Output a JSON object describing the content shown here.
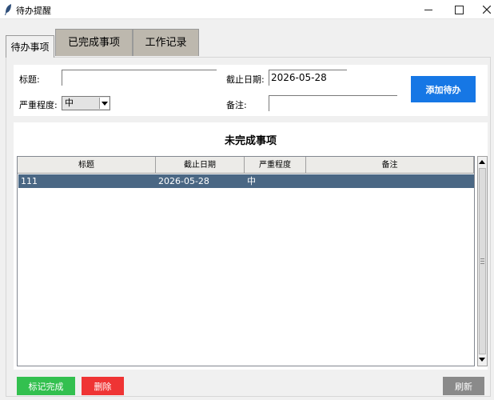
{
  "window": {
    "title": "待办提醒",
    "app_icon": "feather-icon"
  },
  "tabs": [
    {
      "label": "待办事项",
      "active": true
    },
    {
      "label": "已完成事项",
      "active": false
    },
    {
      "label": "工作记录",
      "active": false
    }
  ],
  "form": {
    "title_label": "标题:",
    "title_value": "",
    "due_label": "截止日期:",
    "due_value": "2026-05-28",
    "severity_label": "严重程度:",
    "severity_value": "中",
    "note_label": "备注:",
    "note_value": "",
    "add_button": "添加待办"
  },
  "list": {
    "heading": "未完成事项",
    "columns": [
      "标题",
      "截止日期",
      "严重程度",
      "备注"
    ],
    "rows": [
      {
        "title": "111",
        "due": "2026-05-28",
        "severity": "中",
        "note": "",
        "selected": true
      }
    ]
  },
  "buttons": {
    "complete": "标记完成",
    "delete": "删除",
    "refresh": "刷新"
  },
  "colors": {
    "add_button": "#1677e5",
    "complete_button": "#33c04f",
    "delete_button": "#ef3434",
    "refresh_button": "#8a8a8a",
    "selected_row": "#4a6784"
  }
}
